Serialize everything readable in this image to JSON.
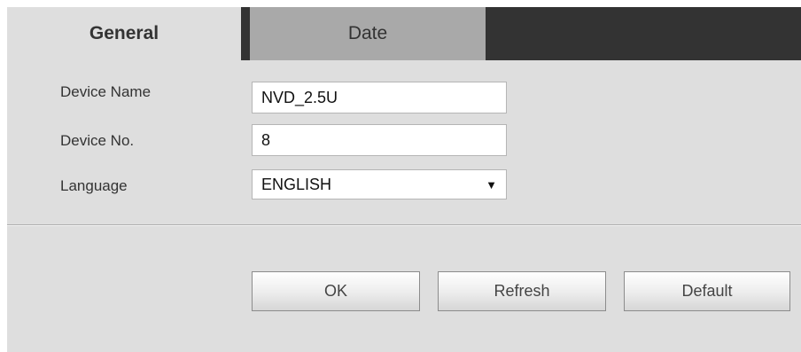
{
  "tabs": [
    {
      "label": "General",
      "active": true
    },
    {
      "label": "Date",
      "active": false
    }
  ],
  "form": {
    "device_name": {
      "label": "Device Name",
      "value": "NVD_2.5U"
    },
    "device_no": {
      "label": "Device No.",
      "value": "8"
    },
    "language": {
      "label": "Language",
      "value": "ENGLISH",
      "arrow": "▼"
    }
  },
  "buttons": {
    "ok": "OK",
    "refresh": "Refresh",
    "default": "Default"
  },
  "colors": {
    "panel_background": "#dedede",
    "tab_bar_dark": "#333333",
    "inactive_tab": "#a9a9a9"
  }
}
